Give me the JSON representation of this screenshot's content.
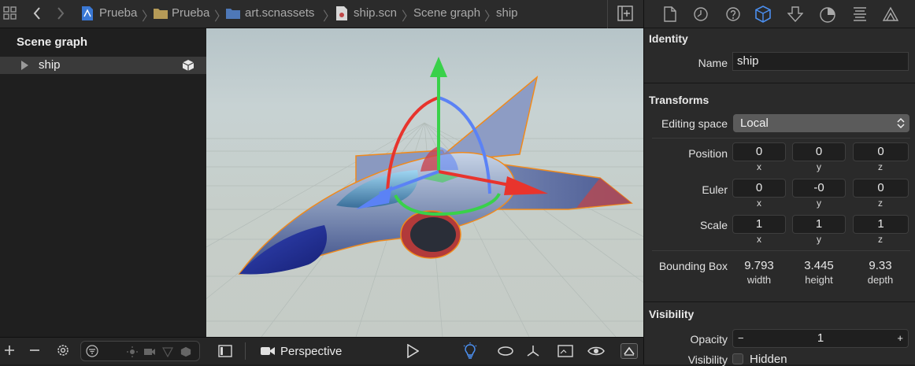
{
  "breadcrumb": {
    "items": [
      "Prueba",
      "Prueba",
      "art.scnassets",
      "ship.scn",
      "Scene graph",
      "ship"
    ]
  },
  "scene_graph": {
    "title": "Scene graph",
    "items": [
      {
        "label": "ship"
      }
    ]
  },
  "viewport": {
    "camera_label": "Perspective"
  },
  "inspector": {
    "identity": {
      "title": "Identity",
      "name_label": "Name",
      "name_value": "ship"
    },
    "transforms": {
      "title": "Transforms",
      "editing_space_label": "Editing space",
      "editing_space_value": "Local",
      "position": {
        "label": "Position",
        "x": "0",
        "y": "0",
        "z": "0"
      },
      "euler": {
        "label": "Euler",
        "x": "0",
        "y": "-0",
        "z": "0"
      },
      "scale": {
        "label": "Scale",
        "x": "1",
        "y": "1",
        "z": "1"
      },
      "axis_labels": {
        "x": "x",
        "y": "y",
        "z": "z"
      },
      "bounding_box": {
        "label": "Bounding Box",
        "width": "9.793",
        "height": "3.445",
        "depth": "9.33",
        "width_label": "width",
        "height_label": "height",
        "depth_label": "depth"
      }
    },
    "visibility": {
      "title": "Visibility",
      "opacity_label": "Opacity",
      "opacity_value": "1",
      "minus": "−",
      "plus": "+",
      "visibility_label": "Visibility",
      "hidden_label": "Hidden"
    }
  },
  "colors": {
    "accent": "#4b8ff0",
    "gizmo_x": "#e8342d",
    "gizmo_y": "#39d14a",
    "gizmo_z": "#5b82f5",
    "selection": "#f08a1c"
  }
}
